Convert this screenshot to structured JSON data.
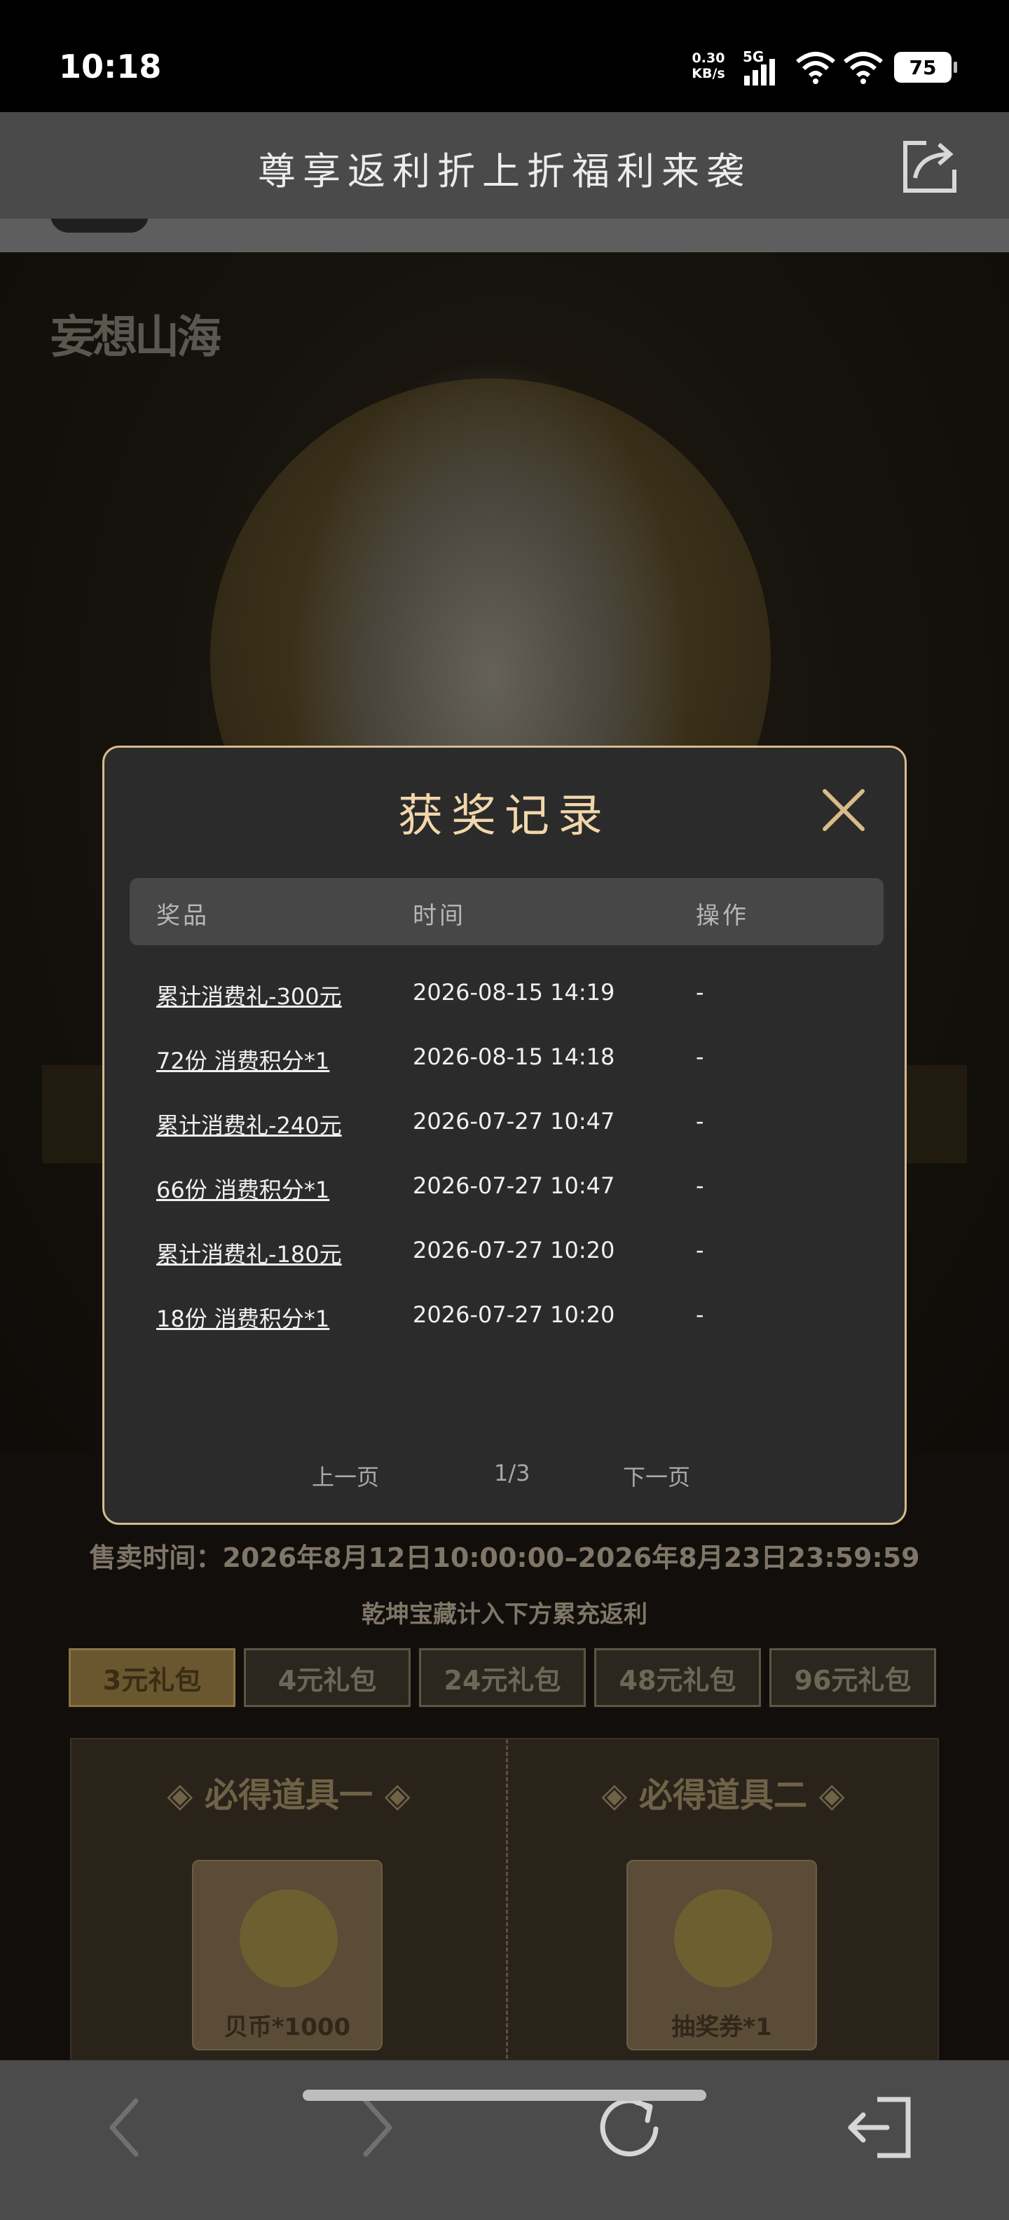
{
  "status_bar": {
    "time": "10:18",
    "net_speed_value": "0.30",
    "net_speed_unit": "KB/s",
    "network_type": "5G",
    "battery": "75"
  },
  "header": {
    "title": "尊享返利折上折福利来袭",
    "share_icon": "share-icon"
  },
  "background_page": {
    "game_logo": "妄想山海",
    "sale_time": "售卖时间：2026年8月12日10:00:00–2026年8月23日23:59:59",
    "sale_note": "乾坤宝藏计入下方累充返利",
    "packs": [
      "3元礼包",
      "4元礼包",
      "24元礼包",
      "48元礼包",
      "96元礼包"
    ],
    "active_pack_index": 0,
    "gift_columns": [
      {
        "title": "◈ 必得道具一 ◈",
        "item": "贝币*1000"
      },
      {
        "title": "◈ 必得道具二 ◈",
        "item": "抽奖券*1"
      }
    ]
  },
  "modal": {
    "title": "获奖记录",
    "close_icon": "close-icon",
    "columns": {
      "prize": "奖品",
      "time": "时间",
      "action": "操作"
    },
    "records": [
      {
        "prize": "累计消费礼-300元",
        "time": "2026-08-15 14:19",
        "action": "-"
      },
      {
        "prize": "72份 消费积分*1",
        "time": "2026-08-15 14:18",
        "action": "-"
      },
      {
        "prize": "累计消费礼-240元",
        "time": "2026-07-27 10:47",
        "action": "-"
      },
      {
        "prize": "66份 消费积分*1",
        "time": "2026-07-27 10:47",
        "action": "-"
      },
      {
        "prize": "累计消费礼-180元",
        "time": "2026-07-27 10:20",
        "action": "-"
      },
      {
        "prize": "18份 消费积分*1",
        "time": "2026-07-27 10:20",
        "action": "-"
      }
    ],
    "pager": {
      "prev": "上一页",
      "page": "1/3",
      "next": "下一页"
    }
  },
  "bottom_nav": {
    "buttons": [
      "back-icon",
      "forward-icon",
      "refresh-icon",
      "exit-icon"
    ]
  }
}
